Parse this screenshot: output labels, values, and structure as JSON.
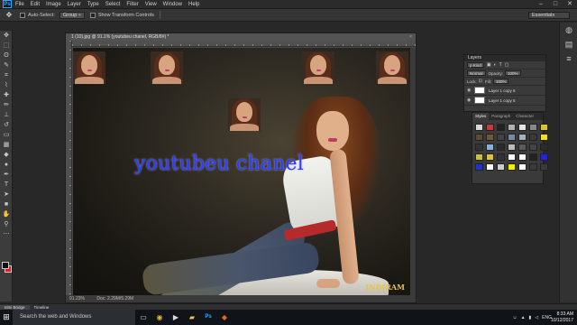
{
  "app": {
    "logo": "Ps",
    "menu": [
      "File",
      "Edit",
      "Image",
      "Layer",
      "Type",
      "Select",
      "Filter",
      "View",
      "Window",
      "Help"
    ]
  },
  "window_controls": [
    "–",
    "□",
    "✕"
  ],
  "options": {
    "move_icon": "move-tool-icon",
    "auto_select_label": "Auto-Select:",
    "auto_select_value": "Group ÷",
    "transform_label": "Show Transform Controls"
  },
  "workspace": "Essentials",
  "document": {
    "tab_title": "1 (10).jpg @ 91.1% (youtubeu chanel, RGB/8#) *",
    "overlay_text": "youtubeu chanel",
    "watermark": "INDIRAM",
    "status_zoom": "91.23%",
    "status_doc": "Doc: 2.29M/5.29M"
  },
  "layers_panel": {
    "title": "Layers",
    "kind": "ρ Kind",
    "blend": "Normal",
    "opacity_label": "Opacity:",
    "opacity": "100%",
    "lock_label": "Lock:",
    "fill_label": "Fill:",
    "fill": "100%",
    "layers": [
      "Layer 1 copy 6",
      "Layer 1 copy 5"
    ]
  },
  "styles_panel": {
    "tabs": [
      "Styles",
      "Paragraph",
      "Character"
    ],
    "swatches": [
      "#d8d8d8",
      "#c23a3a",
      "#222222",
      "#b0b0b0",
      "#e6e6e6",
      "#888888",
      "#d9c13a",
      "#5a4a3a",
      "#6a5a3a",
      "#444444",
      "#7a8aa0",
      "#aab0b8",
      "#3a3a3a",
      "#e8e020",
      "#333333",
      "#8ab0d8",
      "#2a2a2a",
      "#bbbbbb",
      "#5a5a5a",
      "#444444",
      "#2b2b2b",
      "#c8c040",
      "#e0c040",
      "#333333",
      "#ffffff",
      "#ffffff",
      "#222222",
      "#2222dd",
      "#2233cc",
      "#ffffff",
      "#cccccc",
      "#f0f000",
      "#ffffff",
      "#3a3a3a",
      "#3a3a3a"
    ]
  },
  "bottom_tabs": [
    "Mini Bridge",
    "Timeline"
  ],
  "taskbar": {
    "search_placeholder": "Search the web and Windows",
    "lang": "ENG",
    "time": "8:33 AM",
    "date": "10/12/2017"
  },
  "toolbar_icons": [
    "move",
    "marquee",
    "lasso",
    "quick-select",
    "crop",
    "eyedropper",
    "heal",
    "brush",
    "stamp",
    "history",
    "eraser",
    "gradient",
    "blur",
    "dodge",
    "pen",
    "type",
    "path-select",
    "shape",
    "hand",
    "zoom",
    "more"
  ]
}
